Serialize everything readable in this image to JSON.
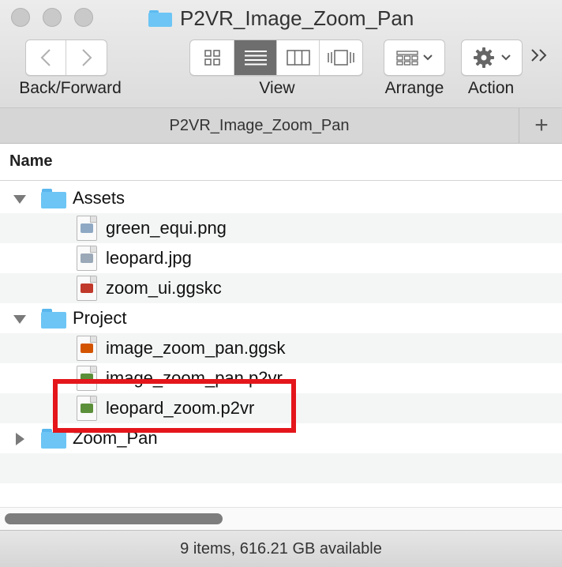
{
  "window": {
    "title": "P2VR_Image_Zoom_Pan",
    "folder_icon": "folder-icon"
  },
  "toolbar": {
    "back_forward_label": "Back/Forward",
    "view_label": "View",
    "arrange_label": "Arrange",
    "action_label": "Action",
    "view_modes": [
      "icon-view",
      "list-view",
      "column-view",
      "cover-flow-view"
    ],
    "selected_view": "list-view",
    "overflow_icon": "double-chevron-right-icon"
  },
  "pathbar": {
    "title": "P2VR_Image_Zoom_Pan",
    "add_tab": "+"
  },
  "columns": {
    "name": "Name"
  },
  "items": [
    {
      "type": "folder",
      "label": "Assets",
      "expanded": true,
      "level": 0
    },
    {
      "type": "file",
      "label": "green_equi.png",
      "icon": "png-file-icon",
      "level": 1
    },
    {
      "type": "file",
      "label": "leopard.jpg",
      "icon": "jpg-file-icon",
      "level": 1
    },
    {
      "type": "file",
      "label": "zoom_ui.ggskc",
      "icon": "ggskc-file-icon",
      "level": 1
    },
    {
      "type": "folder",
      "label": "Project",
      "expanded": true,
      "level": 0
    },
    {
      "type": "file",
      "label": "image_zoom_pan.ggsk",
      "icon": "ggsk-file-icon",
      "level": 1
    },
    {
      "type": "file",
      "label": "image_zoom_pan.p2vr",
      "icon": "p2vr-file-icon",
      "level": 1
    },
    {
      "type": "file",
      "label": "leopard_zoom.p2vr",
      "icon": "p2vr-file-icon",
      "level": 1
    },
    {
      "type": "folder",
      "label": "Zoom_Pan",
      "expanded": false,
      "level": 0
    }
  ],
  "status": {
    "text": "9 items, 616.21 GB available"
  },
  "colors": {
    "folder": "#6cc5f5",
    "highlight": "#e4161b",
    "selected_segment": "#6e6e6e"
  }
}
